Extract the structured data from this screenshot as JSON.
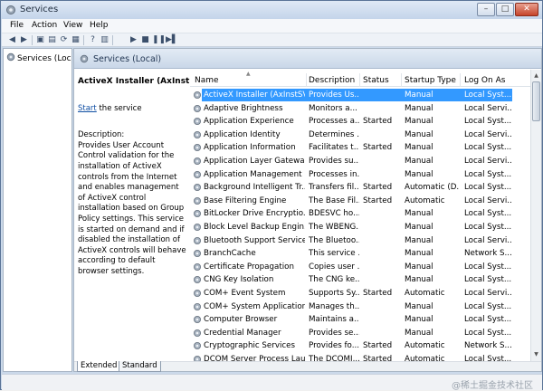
{
  "window": {
    "title": "Services",
    "controls": {
      "minimize": "–",
      "maximize": "□",
      "close": "✕"
    }
  },
  "menu": [
    "File",
    "Action",
    "View",
    "Help"
  ],
  "toolbar": {
    "icons": [
      "back-icon",
      "forward-icon",
      "show-hide-tree-icon",
      "properties-icon",
      "refresh-icon",
      "export-icon",
      "help-icon",
      "tree-view-icon",
      "play-icon",
      "stop-icon",
      "pause-icon",
      "restart-icon"
    ]
  },
  "tree": {
    "item": "Services (Local)"
  },
  "header": {
    "title": "Services (Local)"
  },
  "detail": {
    "title": "ActiveX Installer (AxInstSV)",
    "start_link": "Start",
    "start_rest": " the service",
    "desc_label": "Description:",
    "desc": "Provides User Account Control validation for the installation of ActiveX controls from the Internet and enables management of ActiveX control installation based on Group Policy settings. This service is started on demand and if disabled the installation of ActiveX controls will behave according to default browser settings."
  },
  "columns": [
    "Name",
    "Description",
    "Status",
    "Startup Type",
    "Log On As"
  ],
  "rows": [
    {
      "name": "ActiveX Installer (AxInstSV)",
      "desc": "Provides Us...",
      "status": "",
      "startup": "Manual",
      "logon": "Local Syst...",
      "selected": true
    },
    {
      "name": "Adaptive Brightness",
      "desc": "Monitors a...",
      "status": "",
      "startup": "Manual",
      "logon": "Local Servi..."
    },
    {
      "name": "Application Experience",
      "desc": "Processes a...",
      "status": "Started",
      "startup": "Manual",
      "logon": "Local Syst..."
    },
    {
      "name": "Application Identity",
      "desc": "Determines ...",
      "status": "",
      "startup": "Manual",
      "logon": "Local Servi..."
    },
    {
      "name": "Application Information",
      "desc": "Facilitates t...",
      "status": "Started",
      "startup": "Manual",
      "logon": "Local Syst..."
    },
    {
      "name": "Application Layer Gatewa...",
      "desc": "Provides su...",
      "status": "",
      "startup": "Manual",
      "logon": "Local Servi..."
    },
    {
      "name": "Application Management",
      "desc": "Processes in...",
      "status": "",
      "startup": "Manual",
      "logon": "Local Syst..."
    },
    {
      "name": "Background Intelligent Tr...",
      "desc": "Transfers fil...",
      "status": "Started",
      "startup": "Automatic (D...",
      "logon": "Local Syst..."
    },
    {
      "name": "Base Filtering Engine",
      "desc": "The Base Fil...",
      "status": "Started",
      "startup": "Automatic",
      "logon": "Local Servi..."
    },
    {
      "name": "BitLocker Drive Encryptio...",
      "desc": "BDESVC ho...",
      "status": "",
      "startup": "Manual",
      "logon": "Local Syst..."
    },
    {
      "name": "Block Level Backup Engin...",
      "desc": "The WBENG...",
      "status": "",
      "startup": "Manual",
      "logon": "Local Syst..."
    },
    {
      "name": "Bluetooth Support Service",
      "desc": "The Bluetoo...",
      "status": "",
      "startup": "Manual",
      "logon": "Local Servi..."
    },
    {
      "name": "BranchCache",
      "desc": "This service ...",
      "status": "",
      "startup": "Manual",
      "logon": "Network S..."
    },
    {
      "name": "Certificate Propagation",
      "desc": "Copies user ...",
      "status": "",
      "startup": "Manual",
      "logon": "Local Syst..."
    },
    {
      "name": "CNG Key Isolation",
      "desc": "The CNG ke...",
      "status": "",
      "startup": "Manual",
      "logon": "Local Syst..."
    },
    {
      "name": "COM+ Event System",
      "desc": "Supports Sy...",
      "status": "Started",
      "startup": "Automatic",
      "logon": "Local Servi..."
    },
    {
      "name": "COM+ System Application",
      "desc": "Manages th...",
      "status": "",
      "startup": "Manual",
      "logon": "Local Syst..."
    },
    {
      "name": "Computer Browser",
      "desc": "Maintains a...",
      "status": "",
      "startup": "Manual",
      "logon": "Local Syst..."
    },
    {
      "name": "Credential Manager",
      "desc": "Provides se...",
      "status": "",
      "startup": "Manual",
      "logon": "Local Syst..."
    },
    {
      "name": "Cryptographic Services",
      "desc": "Provides fo...",
      "status": "Started",
      "startup": "Automatic",
      "logon": "Network S..."
    },
    {
      "name": "DCOM Server Process Lau...",
      "desc": "The DCOMI...",
      "status": "Started",
      "startup": "Automatic",
      "logon": "Local Syst..."
    }
  ],
  "tabs": [
    "Extended",
    "Standard"
  ],
  "watermark": "@稀土掘金技术社区"
}
